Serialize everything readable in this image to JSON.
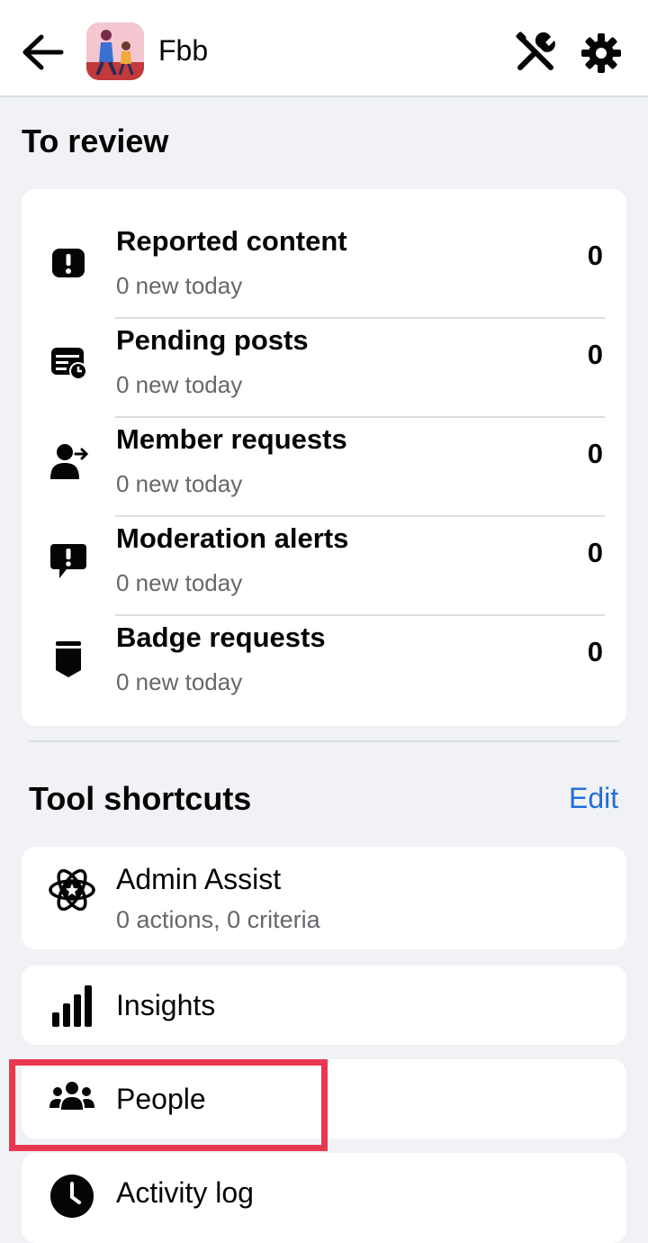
{
  "header": {
    "group_name": "Fbb"
  },
  "to_review": {
    "title": "To review",
    "items": [
      {
        "label": "Reported content",
        "sub": "0 new today",
        "count": "0",
        "icon": "exclamation-icon"
      },
      {
        "label": "Pending posts",
        "sub": "0 new today",
        "count": "0",
        "icon": "pending-posts-icon"
      },
      {
        "label": "Member requests",
        "sub": "0 new today",
        "count": "0",
        "icon": "member-request-icon"
      },
      {
        "label": "Moderation alerts",
        "sub": "0 new today",
        "count": "0",
        "icon": "alert-bubble-icon"
      },
      {
        "label": "Badge requests",
        "sub": "0 new today",
        "count": "0",
        "icon": "badge-icon"
      }
    ]
  },
  "tool_shortcuts": {
    "title": "Tool shortcuts",
    "edit_label": "Edit",
    "items": [
      {
        "label": "Admin Assist",
        "sub": "0 actions, 0 criteria",
        "icon": "admin-assist-icon"
      },
      {
        "label": "Insights",
        "icon": "insights-icon"
      },
      {
        "label": "People",
        "icon": "people-icon"
      },
      {
        "label": "Activity log",
        "icon": "clock-icon"
      }
    ]
  },
  "colors": {
    "accent": "#216fdb",
    "highlight": "#e8384f",
    "background": "#f0f2f5"
  }
}
